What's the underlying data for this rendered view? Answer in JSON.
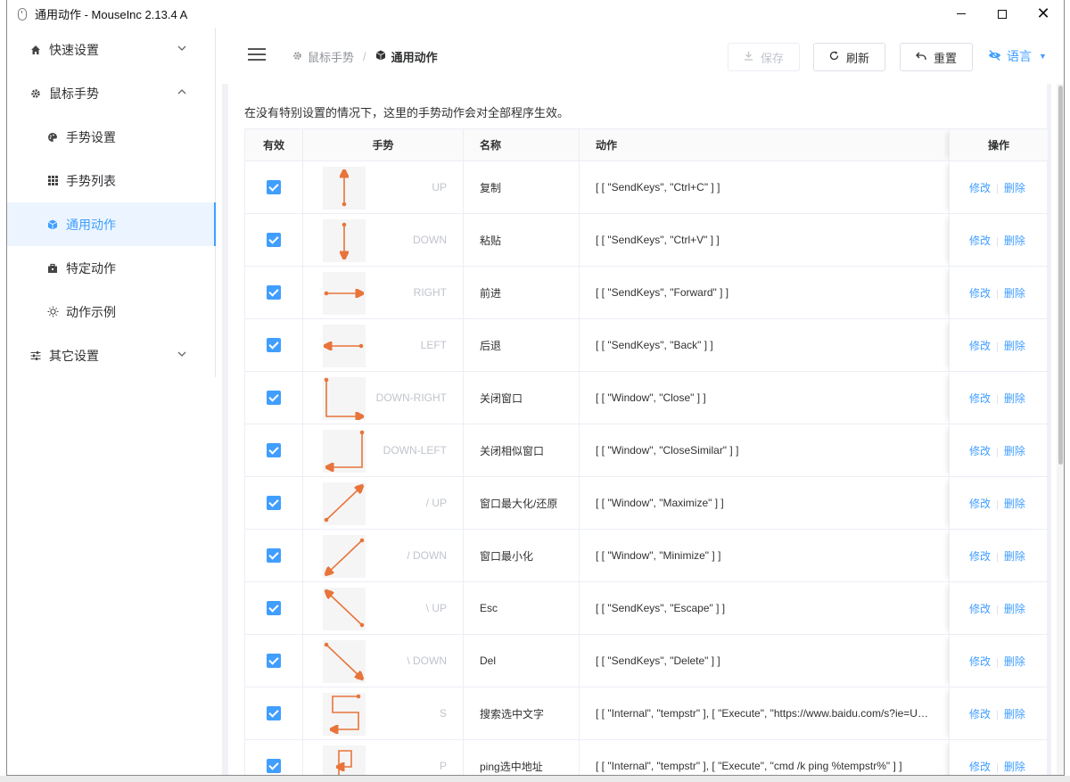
{
  "window": {
    "title": "通用动作 - MouseInc 2.13.4 A"
  },
  "sidebar": {
    "items": [
      {
        "label": "快速设置",
        "icon": "home-icon",
        "level": "top",
        "arrow": "down"
      },
      {
        "label": "鼠标手势",
        "icon": "gear-icon",
        "level": "top",
        "arrow": "up"
      },
      {
        "label": "手势设置",
        "icon": "palette-icon",
        "level": "sub"
      },
      {
        "label": "手势列表",
        "icon": "grid-icon",
        "level": "sub"
      },
      {
        "label": "通用动作",
        "icon": "cube-icon",
        "level": "sub",
        "active": true
      },
      {
        "label": "特定动作",
        "icon": "briefcase-icon",
        "level": "sub"
      },
      {
        "label": "动作示例",
        "icon": "sun-icon",
        "level": "sub"
      },
      {
        "label": "其它设置",
        "icon": "sliders-icon",
        "level": "top",
        "arrow": "down"
      }
    ]
  },
  "header": {
    "breadcrumb": [
      {
        "label": "鼠标手势",
        "icon": "gear-icon"
      },
      {
        "label": "通用动作",
        "icon": "cube-icon"
      }
    ],
    "breadcrumb_sep": "/",
    "save_label": "保存",
    "refresh_label": "刷新",
    "reset_label": "重置",
    "language_label": "语言"
  },
  "main": {
    "intro": "在没有特别设置的情况下，这里的手势动作会对全部程序生效。",
    "columns": {
      "enabled": "有效",
      "gesture": "手势",
      "name": "名称",
      "action": "动作",
      "ops": "操作"
    },
    "edit_label": "修改",
    "delete_label": "删除",
    "rows": [
      {
        "enabled": true,
        "gesture": "UP",
        "name": "复制",
        "action": "[ [ \"SendKeys\", \"Ctrl+C\" ] ]"
      },
      {
        "enabled": true,
        "gesture": "DOWN",
        "name": "粘贴",
        "action": "[ [ \"SendKeys\", \"Ctrl+V\" ] ]"
      },
      {
        "enabled": true,
        "gesture": "RIGHT",
        "name": "前进",
        "action": "[ [ \"SendKeys\", \"Forward\" ] ]"
      },
      {
        "enabled": true,
        "gesture": "LEFT",
        "name": "后退",
        "action": "[ [ \"SendKeys\", \"Back\" ] ]"
      },
      {
        "enabled": true,
        "gesture": "DOWN-RIGHT",
        "name": "关闭窗口",
        "action": "[ [ \"Window\", \"Close\" ] ]"
      },
      {
        "enabled": true,
        "gesture": "DOWN-LEFT",
        "name": "关闭相似窗口",
        "action": "[ [ \"Window\", \"CloseSimilar\" ] ]"
      },
      {
        "enabled": true,
        "gesture": "/ UP",
        "name": "窗口最大化/还原",
        "action": "[ [ \"Window\", \"Maximize\" ] ]"
      },
      {
        "enabled": true,
        "gesture": "/ DOWN",
        "name": "窗口最小化",
        "action": "[ [ \"Window\", \"Minimize\" ] ]"
      },
      {
        "enabled": true,
        "gesture": "\\ UP",
        "name": "Esc",
        "action": "[ [ \"SendKeys\", \"Escape\" ] ]"
      },
      {
        "enabled": true,
        "gesture": "\\ DOWN",
        "name": "Del",
        "action": "[ [ \"SendKeys\", \"Delete\" ] ]"
      },
      {
        "enabled": true,
        "gesture": "S",
        "name": "搜索选中文字",
        "action": "[ [ \"Internal\", \"tempstr\" ], [ \"Execute\", \"https://www.baidu.com/s?ie=U…"
      },
      {
        "enabled": true,
        "gesture": "P",
        "name": "ping选中地址",
        "action": "[ [ \"Internal\", \"tempstr\" ], [ \"Execute\", \"cmd /k ping %tempstr%\" ] ]"
      }
    ]
  },
  "colors": {
    "accent": "#409eff",
    "gesture_stroke": "#e8743b",
    "main_bg": "#f0f2f5"
  }
}
